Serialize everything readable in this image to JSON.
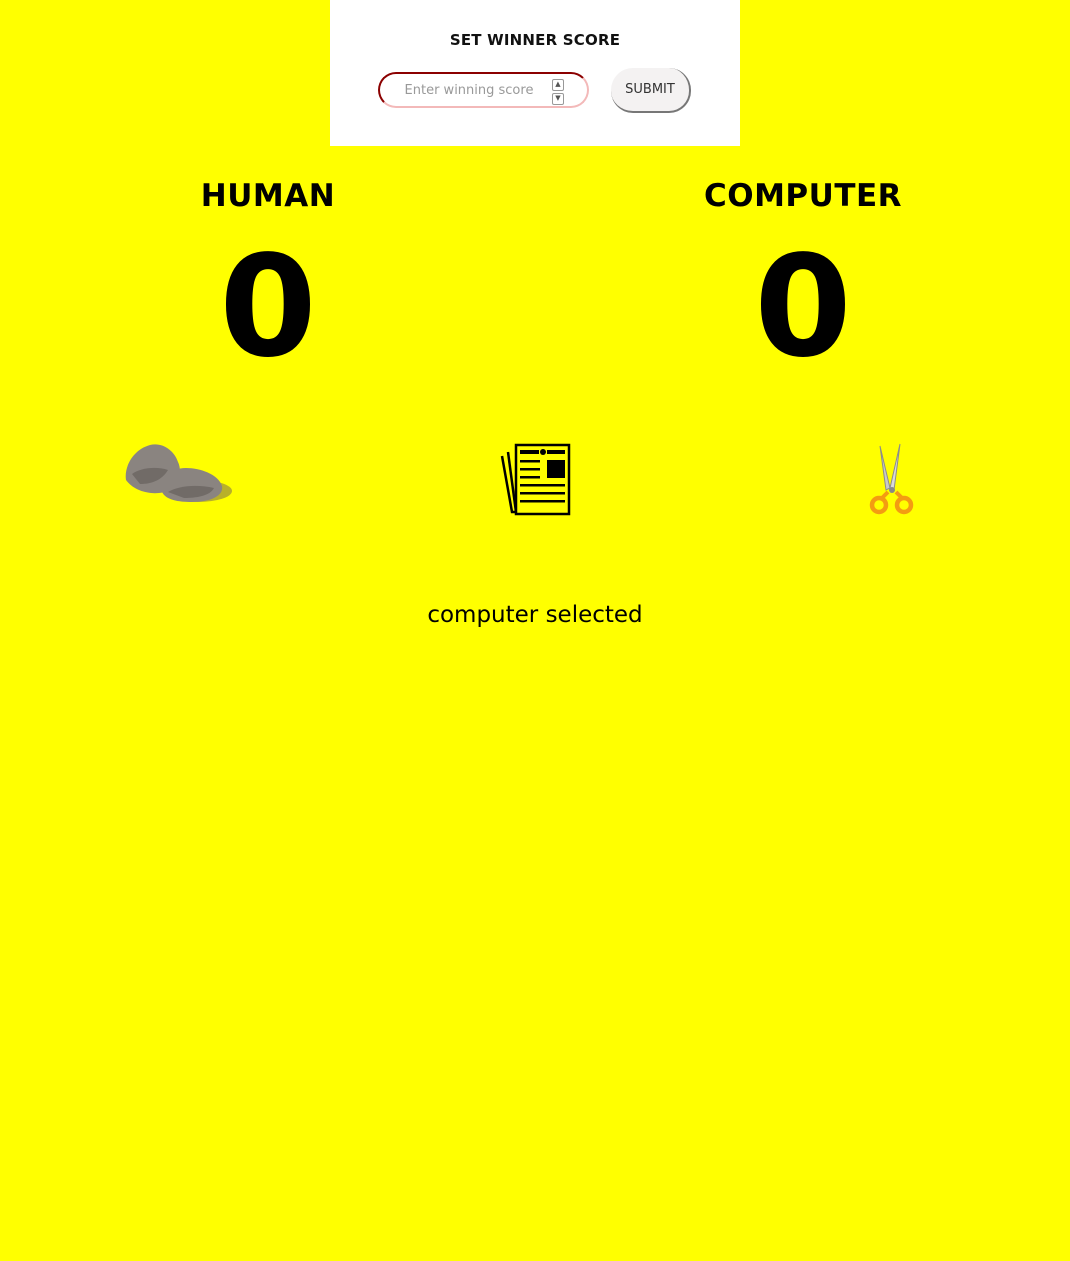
{
  "settings": {
    "title": "SET WINNER SCORE",
    "input_placeholder": "Enter winning score",
    "submit_label": "SUBMIT"
  },
  "players": {
    "human": {
      "label": "HUMAN",
      "score": "0"
    },
    "computer": {
      "label": "COMPUTER",
      "score": "0"
    }
  },
  "choices": [
    {
      "name": "rock",
      "icon": "rock-icon"
    },
    {
      "name": "paper",
      "icon": "paper-icon"
    },
    {
      "name": "scissors",
      "icon": "scissors-icon"
    }
  ],
  "status": "computer selected",
  "colors": {
    "background": "#ffff00",
    "panel": "#ffffff",
    "text": "#000000",
    "rock": "#8a8480",
    "scissors_handle": "#f39c12"
  }
}
